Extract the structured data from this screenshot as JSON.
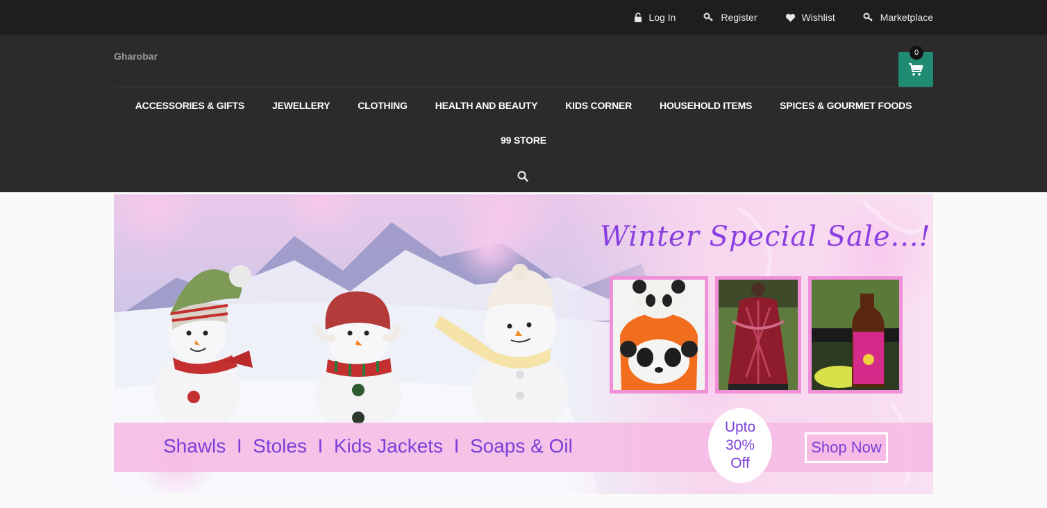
{
  "topbar": {
    "links": [
      {
        "label": "Log In",
        "icon": "lock-icon"
      },
      {
        "label": "Register",
        "icon": "key-icon"
      },
      {
        "label": "Wishlist",
        "icon": "heart-icon"
      },
      {
        "label": "Marketplace",
        "icon": "key-icon"
      }
    ]
  },
  "header": {
    "logo": "Gharobar",
    "cart_count": "0",
    "nav": [
      "ACCESSORIES & GIFTS",
      "JEWELLERY",
      "CLOTHING",
      "HEALTH AND BEAUTY",
      "KIDS CORNER",
      "HOUSEHOLD ITEMS",
      "SPICES & GOURMET FOODS",
      "99 STORE"
    ]
  },
  "banner": {
    "title": "Winter Special Sale...!",
    "categories": "Shawls  I  Stoles  I  Kids Jackets  I  Soaps & Oil",
    "offer_line1": "Upto",
    "offer_line2": "30%",
    "offer_line3": "Off",
    "cta": "Shop Now"
  },
  "colors": {
    "topbar_bg": "#1e1e1e",
    "header_bg": "#2b2b2b",
    "cart_bg": "#1f8b72",
    "banner_accent": "#7b3fd8",
    "banner_pink": "#f6bae4"
  }
}
